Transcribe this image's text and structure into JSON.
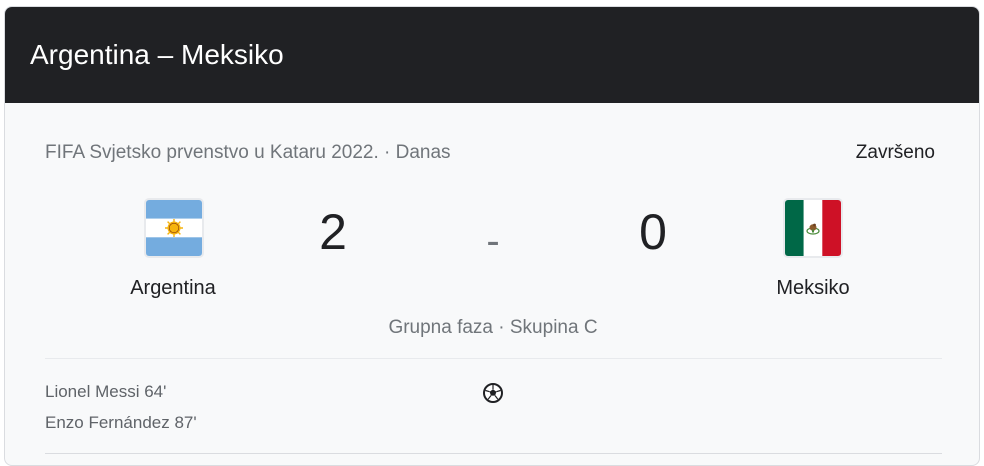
{
  "header": {
    "title": "Argentina – Meksiko"
  },
  "match": {
    "competition": "FIFA Svjetsko prvenstvo u Kataru 2022. · Danas",
    "status": "Završeno",
    "stage": "Grupna faza · Skupina C",
    "separator": "-"
  },
  "home": {
    "name": "Argentina",
    "score": "2",
    "flag_icon": "argentina-flag-icon"
  },
  "away": {
    "name": "Meksiko",
    "score": "0",
    "flag_icon": "mexico-flag-icon"
  },
  "scorers": [
    {
      "text": "Lionel Messi 64'"
    },
    {
      "text": "Enzo Fernández 87'"
    }
  ],
  "icons": {
    "goal": "soccer-ball-icon"
  },
  "colors": {
    "header_bg": "#202124",
    "card_bg": "#f8f9fa",
    "argentina_blue": "#74acdf",
    "mexico_green": "#006847",
    "mexico_red": "#ce1126"
  }
}
